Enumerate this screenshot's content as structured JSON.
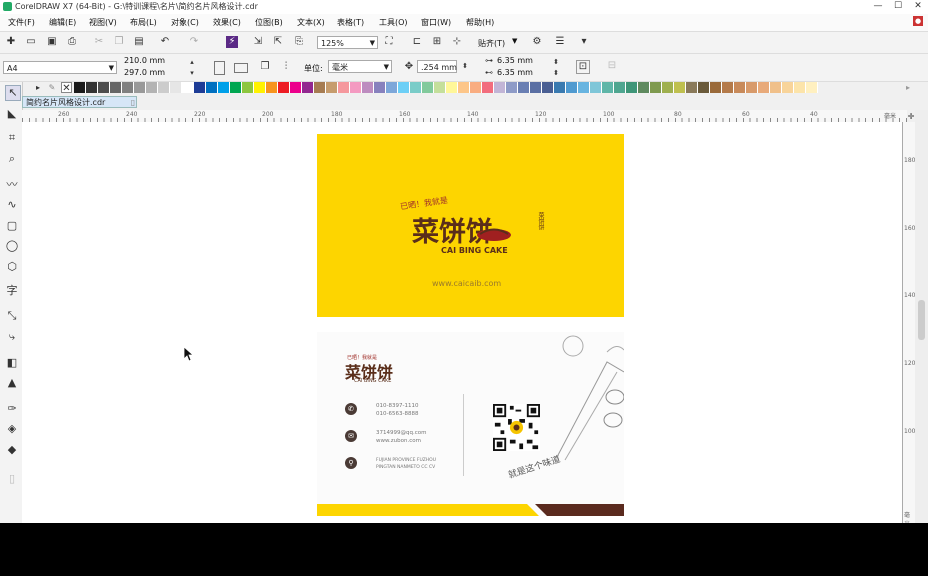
{
  "window": {
    "title": "CorelDRAW X7 (64-Bit) - G:\\特训课程\\名片\\简约名片风格设计.cdr",
    "minimize": "—",
    "maximize": "☐",
    "close": "✕"
  },
  "menu": [
    "文件(F)",
    "编辑(E)",
    "视图(V)",
    "布局(L)",
    "对象(C)",
    "效果(C)",
    "位图(B)",
    "文本(X)",
    "表格(T)",
    "工具(O)",
    "窗口(W)",
    "帮助(H)"
  ],
  "toolbar": {
    "zoom": "125%",
    "snap_label": "贴齐(T)"
  },
  "property_bar": {
    "page_size": "A4",
    "width": "210.0 mm",
    "height": "297.0 mm",
    "units_label": "单位:",
    "units_value": "毫米",
    "nudge": ".254 mm",
    "dup_x": "6.35 mm",
    "dup_y": "6.35 mm"
  },
  "document_tab": "简约名片风格设计.cdr",
  "ruler": {
    "h_labels": [
      "260",
      "240",
      "220",
      "200",
      "180",
      "160",
      "140",
      "120",
      "100",
      "80",
      "60",
      "40"
    ],
    "h_unit": "毫米",
    "v_labels": [
      "180",
      "160",
      "140",
      "120",
      "100"
    ],
    "v_unit": "毫米"
  },
  "palette_colors": [
    "#1a1a1a",
    "#333333",
    "#4d4d4d",
    "#666666",
    "#808080",
    "#999999",
    "#b3b3b3",
    "#cccccc",
    "#e6e6e6",
    "#ffffff",
    "#1e3c96",
    "#0070c0",
    "#00a0e9",
    "#00a651",
    "#8dc63f",
    "#fff200",
    "#f7941d",
    "#ed1c24",
    "#ec008c",
    "#92278f",
    "#a67c52",
    "#c69c6d",
    "#f5989d",
    "#f49ac1",
    "#bd8cbf",
    "#8781bd",
    "#7da7d9",
    "#6dcff6",
    "#7accc8",
    "#82ca9c",
    "#c4df9b",
    "#fff799",
    "#fdc689",
    "#f9ad81",
    "#f26d7d",
    "#c2b5d6",
    "#8e9bc7",
    "#6a7fb3",
    "#5a6fa3",
    "#4a5f93",
    "#3a7ab0",
    "#4f9ad0",
    "#68b4e0",
    "#7fc6d8",
    "#5fb6a8",
    "#4fa690",
    "#3f9678",
    "#5f8a5f",
    "#7f9a4f",
    "#9fb04f",
    "#bfc04f",
    "#8a7a5a",
    "#6a5a3a",
    "#9a6a3a",
    "#b47a4a",
    "#c88a5a",
    "#d89a6a",
    "#e8aa7a",
    "#f0c08a",
    "#f8d49a",
    "#fce4aa",
    "#fff0c0"
  ],
  "card_front": {
    "tagline": "已晒！我就是",
    "logo": "菜饼饼",
    "logo_side": "菜饼饼",
    "subtitle": "CAI BING CAKE",
    "website": "www.caicaib.com"
  },
  "card_back": {
    "tagline": "已晒！我就是",
    "logo": "菜饼饼",
    "subtitle": "CAI BING CAKE",
    "phone1": "010-8397-1110",
    "phone2": "010-6563-8888",
    "email1": "3714999@qq.com",
    "email2": "www.zubon.com",
    "addr1": "FUJIAN PROVINCE FUZHOU",
    "addr2": "PINGTAN NANMETO CC CV",
    "slogan": "就是这个味道"
  },
  "colors": {
    "card_yellow": "#fdd500",
    "brand_brown": "#5a2e1a",
    "palette_highlight": "#1e3c96"
  }
}
